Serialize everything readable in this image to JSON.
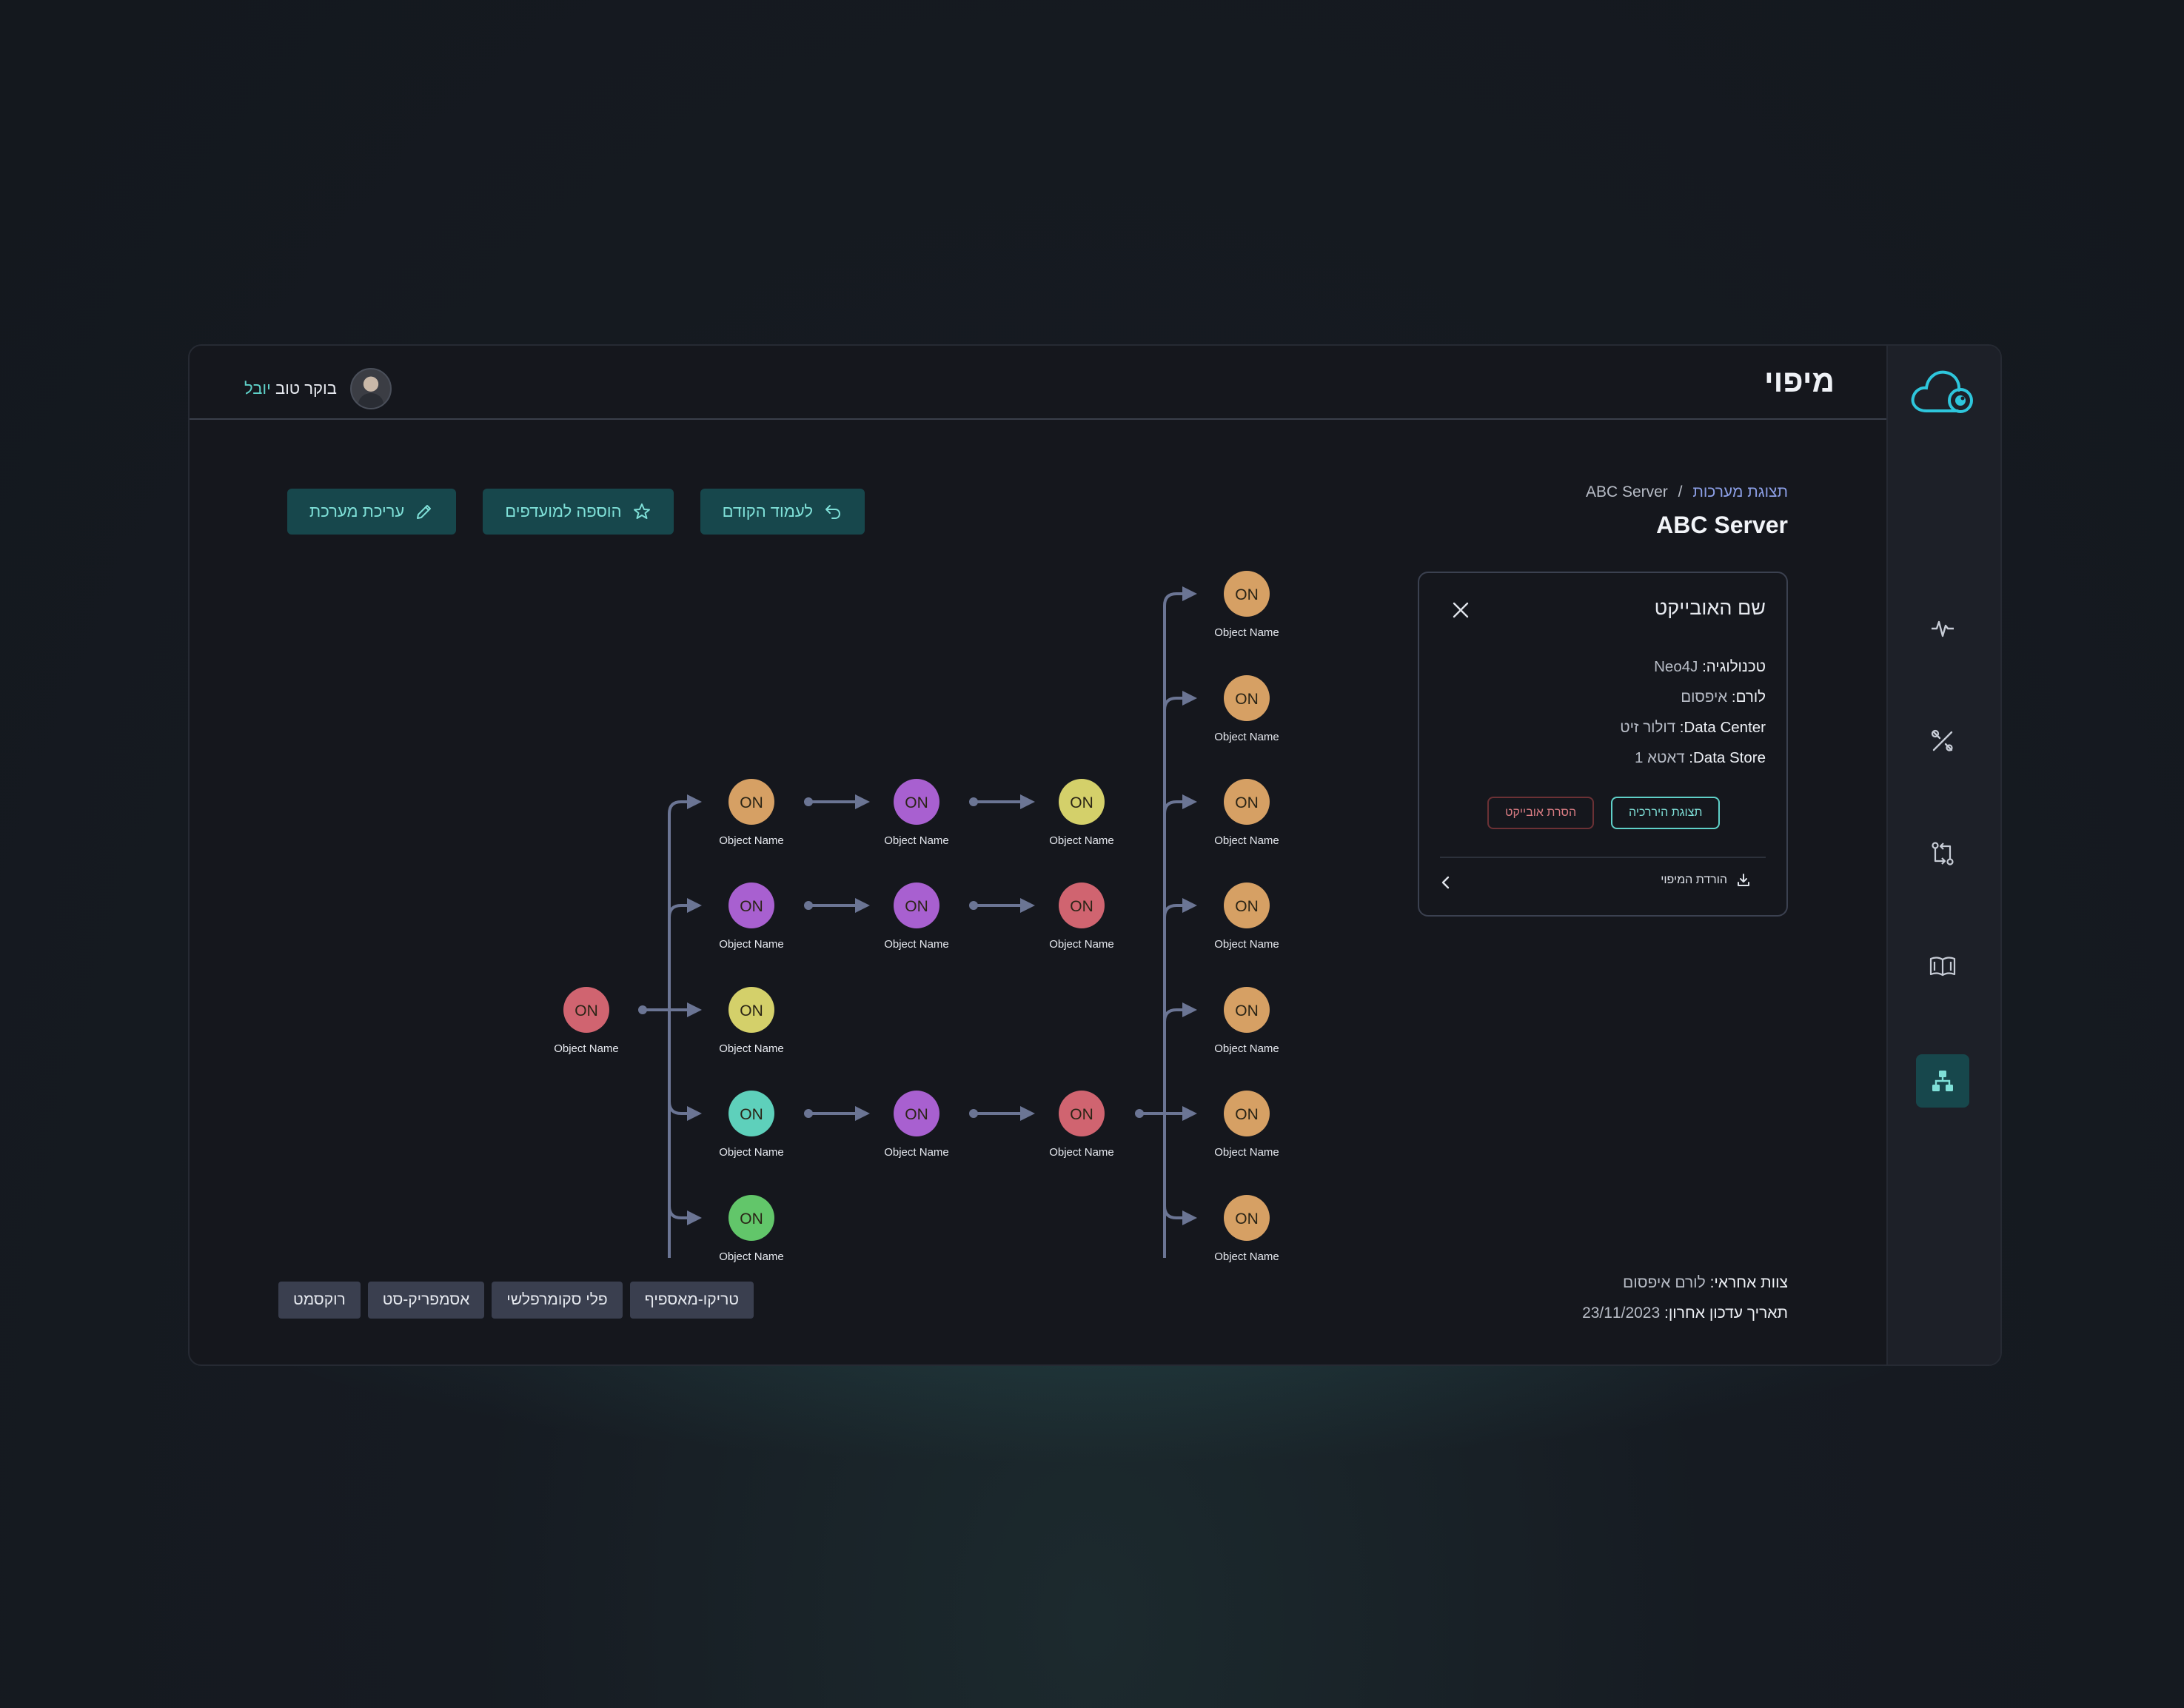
{
  "header": {
    "page_title": "מיפוי",
    "greeting": "בוקר טוב",
    "user_name": "יובל"
  },
  "sidebar": {
    "items": [
      {
        "icon": "activity-icon"
      },
      {
        "icon": "tools-icon"
      },
      {
        "icon": "sync-icon"
      },
      {
        "icon": "book-icon"
      },
      {
        "icon": "hierarchy-icon",
        "active": true
      }
    ]
  },
  "actions": {
    "back": "לעמוד הקודם",
    "favorite": "הוספה למועדפים",
    "edit": "עריכת מערכת"
  },
  "breadcrumb": {
    "parent": "תצוגת מערכות",
    "separator": "/",
    "current": "ABC Server"
  },
  "server_title": "ABC Server",
  "panel": {
    "title": "שם האובייקט",
    "rows": [
      {
        "key": "טכנולוגיה:",
        "value": "Neo4J"
      },
      {
        "key": "לורם:",
        "value": "איפסום"
      },
      {
        "key": "Data Center:",
        "value": "דולור זיט"
      },
      {
        "key": "Data Store:",
        "value": "דאטא 1"
      }
    ],
    "hierarchy_button": "תצוגת היררכיה",
    "remove_button": "הסרת אובייקט",
    "download": "הורדת המיפוי"
  },
  "meta": {
    "team_label": "צוות אחראי:",
    "team_value": "לורם איפסום",
    "updated_label": "תאריך עדכון אחרון:",
    "updated_value": "23/11/2023"
  },
  "tags": [
    "רוקסמט",
    "אסמפריק-סט",
    "פלי סקומרפלשי",
    "טריקו-מאספיף"
  ],
  "colors": {
    "accent": "#5fd0c8",
    "button_bg": "#17474c",
    "node_orange": "#d6a064",
    "node_purple": "#a860d0",
    "node_yellow": "#d4d06a",
    "node_red": "#d06470",
    "node_teal": "#5ed0bb",
    "node_green": "#62c66a",
    "connector": "#6b7594"
  },
  "graph": {
    "node_status": "ON",
    "node_label": "Object Name",
    "nodes": [
      {
        "id": "root",
        "color": "red"
      },
      {
        "id": "c1r1",
        "color": "orange"
      },
      {
        "id": "c1r2",
        "color": "purple"
      },
      {
        "id": "c1r3",
        "color": "yellow"
      },
      {
        "id": "c1r4",
        "color": "teal"
      },
      {
        "id": "c1r5",
        "color": "green"
      },
      {
        "id": "c2r1",
        "color": "purple"
      },
      {
        "id": "c2r2",
        "color": "purple"
      },
      {
        "id": "c2r4",
        "color": "purple"
      },
      {
        "id": "c3r1",
        "color": "yellow"
      },
      {
        "id": "c3r2",
        "color": "red"
      },
      {
        "id": "c3r4",
        "color": "red"
      },
      {
        "id": "c4r1",
        "color": "orange"
      },
      {
        "id": "c4r2",
        "color": "orange"
      },
      {
        "id": "c4r3",
        "color": "orange"
      },
      {
        "id": "c4r4",
        "color": "orange"
      },
      {
        "id": "c4r5",
        "color": "orange"
      },
      {
        "id": "c4r6",
        "color": "orange"
      },
      {
        "id": "c4r7",
        "color": "orange"
      }
    ]
  }
}
